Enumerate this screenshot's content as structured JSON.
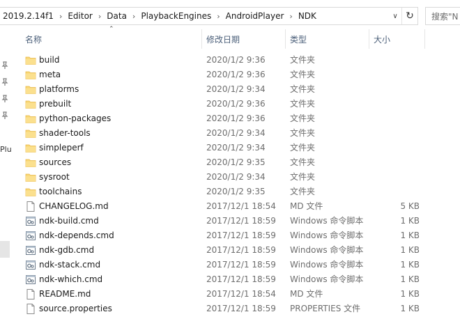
{
  "address": {
    "crumbs": [
      "2019.2.14f1",
      "Editor",
      "Data",
      "PlaybackEngines",
      "AndroidPlayer",
      "NDK"
    ],
    "separator": "›",
    "dropdown_icon": "chevron-down-icon",
    "refresh_icon": "refresh-icon"
  },
  "search": {
    "placeholder": "搜索\"N"
  },
  "nav": {
    "label": "Plu"
  },
  "columns": {
    "name": "名称",
    "date": "修改日期",
    "type": "类型",
    "size": "大小",
    "sort_icon": "sort-up-icon"
  },
  "files": [
    {
      "name": "build",
      "date": "2020/1/2 9:36",
      "type": "文件夹",
      "size": "",
      "icon": "folder"
    },
    {
      "name": "meta",
      "date": "2020/1/2 9:36",
      "type": "文件夹",
      "size": "",
      "icon": "folder"
    },
    {
      "name": "platforms",
      "date": "2020/1/2 9:34",
      "type": "文件夹",
      "size": "",
      "icon": "folder"
    },
    {
      "name": "prebuilt",
      "date": "2020/1/2 9:36",
      "type": "文件夹",
      "size": "",
      "icon": "folder"
    },
    {
      "name": "python-packages",
      "date": "2020/1/2 9:36",
      "type": "文件夹",
      "size": "",
      "icon": "folder"
    },
    {
      "name": "shader-tools",
      "date": "2020/1/2 9:34",
      "type": "文件夹",
      "size": "",
      "icon": "folder"
    },
    {
      "name": "simpleperf",
      "date": "2020/1/2 9:34",
      "type": "文件夹",
      "size": "",
      "icon": "folder"
    },
    {
      "name": "sources",
      "date": "2020/1/2 9:35",
      "type": "文件夹",
      "size": "",
      "icon": "folder"
    },
    {
      "name": "sysroot",
      "date": "2020/1/2 9:34",
      "type": "文件夹",
      "size": "",
      "icon": "folder"
    },
    {
      "name": "toolchains",
      "date": "2020/1/2 9:35",
      "type": "文件夹",
      "size": "",
      "icon": "folder"
    },
    {
      "name": "CHANGELOG.md",
      "date": "2017/12/1 18:54",
      "type": "MD 文件",
      "size": "5 KB",
      "icon": "document"
    },
    {
      "name": "ndk-build.cmd",
      "date": "2017/12/1 18:59",
      "type": "Windows 命令脚本",
      "size": "1 KB",
      "icon": "script"
    },
    {
      "name": "ndk-depends.cmd",
      "date": "2017/12/1 18:59",
      "type": "Windows 命令脚本",
      "size": "1 KB",
      "icon": "script"
    },
    {
      "name": "ndk-gdb.cmd",
      "date": "2017/12/1 18:59",
      "type": "Windows 命令脚本",
      "size": "1 KB",
      "icon": "script"
    },
    {
      "name": "ndk-stack.cmd",
      "date": "2017/12/1 18:59",
      "type": "Windows 命令脚本",
      "size": "1 KB",
      "icon": "script"
    },
    {
      "name": "ndk-which.cmd",
      "date": "2017/12/1 18:59",
      "type": "Windows 命令脚本",
      "size": "1 KB",
      "icon": "script"
    },
    {
      "name": "README.md",
      "date": "2017/12/1 18:54",
      "type": "MD 文件",
      "size": "1 KB",
      "icon": "document"
    },
    {
      "name": "source.properties",
      "date": "2017/12/1 18:59",
      "type": "PROPERTIES 文件",
      "size": "1 KB",
      "icon": "document"
    }
  ],
  "colors": {
    "folder": "#f8d775",
    "folder_dark": "#e8b84a",
    "header_text": "#4c607a",
    "meta_text": "#6d6d6d"
  }
}
